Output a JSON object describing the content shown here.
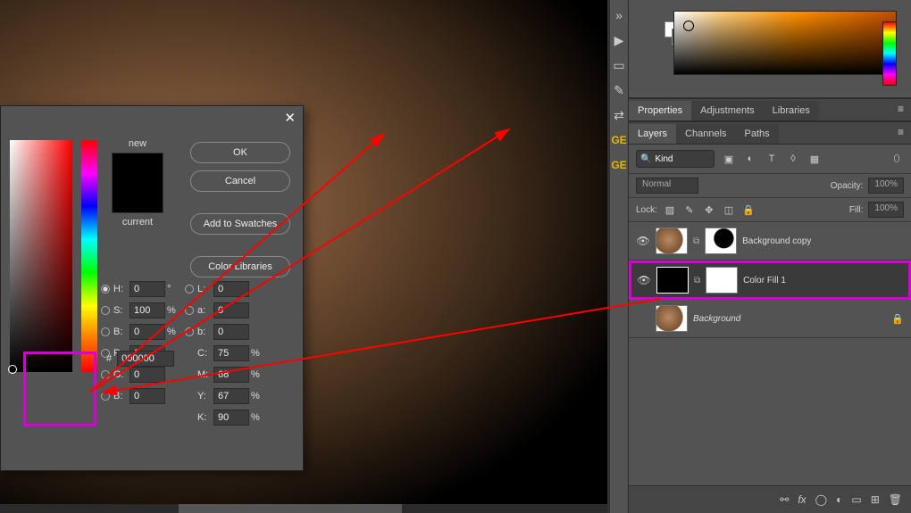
{
  "canvas": {
    "scrollbar": "horizontal"
  },
  "panels": {
    "tabs1": [
      "Properties",
      "Adjustments",
      "Libraries"
    ],
    "tabs2": [
      "Layers",
      "Channels",
      "Paths"
    ],
    "search_placeholder": "Kind",
    "blend_mode": "Normal",
    "opacity_label": "Opacity:",
    "opacity_value": "100%",
    "lock_label": "Lock:",
    "fill_label": "Fill:",
    "fill_value": "100%"
  },
  "layers": [
    {
      "name": "Background copy",
      "visible": true,
      "locked": false,
      "selected": false
    },
    {
      "name": "Color Fill 1",
      "visible": true,
      "locked": false,
      "selected": true
    },
    {
      "name": "Background",
      "visible": true,
      "locked": true,
      "selected": false
    }
  ],
  "sidebar_badge": "GE",
  "picker": {
    "buttons": {
      "ok": "OK",
      "cancel": "Cancel",
      "add": "Add to Swatches",
      "lib": "Color Libraries"
    },
    "labels": {
      "new": "new",
      "current": "current",
      "hash": "#"
    },
    "spaces": {
      "H": {
        "val": "0",
        "unit": "°"
      },
      "S": {
        "val": "100",
        "unit": "%"
      },
      "B": {
        "val": "0",
        "unit": "%"
      },
      "L": {
        "val": "0",
        "unit": ""
      },
      "a": {
        "val": "0",
        "unit": ""
      },
      "b": {
        "val": "0",
        "unit": ""
      },
      "R": {
        "val": "0",
        "unit": ""
      },
      "G": {
        "val": "0",
        "unit": ""
      },
      "Bc": {
        "val": "0",
        "unit": ""
      },
      "C": {
        "val": "75",
        "unit": "%"
      },
      "M": {
        "val": "68",
        "unit": "%"
      },
      "Y": {
        "val": "67",
        "unit": "%"
      },
      "K": {
        "val": "90",
        "unit": "%"
      }
    },
    "hex": "000000"
  }
}
